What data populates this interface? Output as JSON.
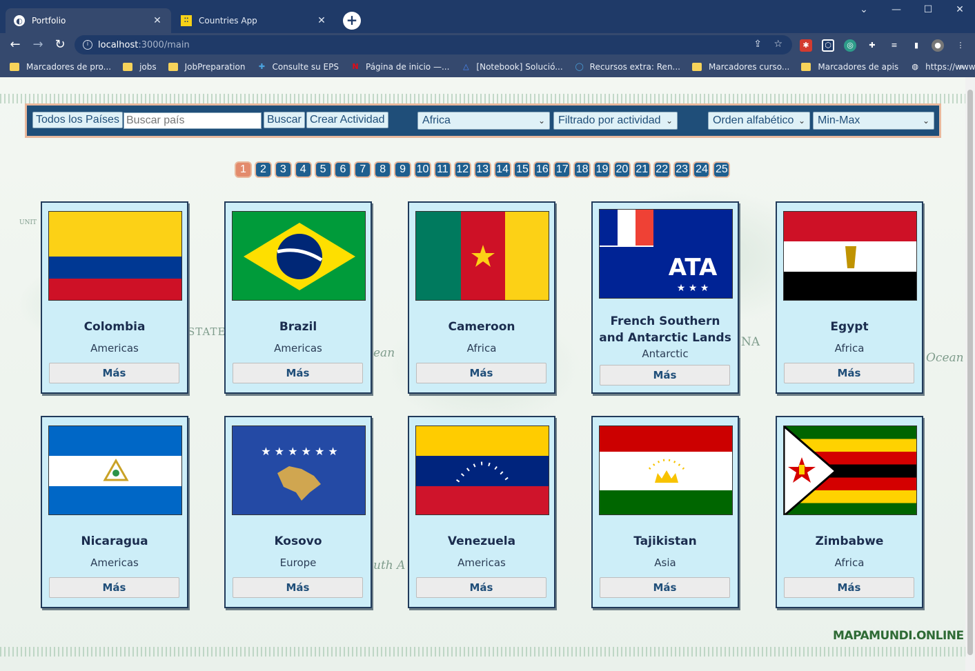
{
  "browser": {
    "tabs": [
      {
        "title": "Portfolio",
        "active": true
      },
      {
        "title": "Countries App",
        "active": false
      }
    ],
    "address": {
      "host": "localhost",
      "path": ":3000/main"
    },
    "bookmarks": [
      "Marcadores de pro...",
      "jobs",
      "JobPreparation",
      "Consulte su EPS",
      "Página de inicio —...",
      "[Notebook] Solució...",
      "Recursos extra: Ren...",
      "Marcadores curso...",
      "Marcadores de apis",
      "https://www.youtub..."
    ],
    "bookmarks_more": "»"
  },
  "nav": {
    "all_countries": "Todos los Países",
    "search_placeholder": "Buscar país",
    "search_button": "Buscar",
    "create_activity": "Crear Actividad",
    "continent_filter": "Africa",
    "activity_filter": "Filtrado por actividad",
    "order_type": "Orden alfabético",
    "order_direction": "Min-Max"
  },
  "pagination": {
    "current": 1,
    "pages": [
      "1",
      "2",
      "3",
      "4",
      "5",
      "6",
      "7",
      "8",
      "9",
      "10",
      "11",
      "12",
      "13",
      "14",
      "15",
      "16",
      "17",
      "18",
      "19",
      "20",
      "21",
      "22",
      "23",
      "24",
      "25"
    ]
  },
  "countries": [
    {
      "name": "Colombia",
      "continent": "Americas",
      "more": "Más"
    },
    {
      "name": "Brazil",
      "continent": "Americas",
      "more": "Más"
    },
    {
      "name": "Cameroon",
      "continent": "Africa",
      "more": "Más"
    },
    {
      "name": "French Southern and Antarctic Lands",
      "continent": "Antarctic",
      "more": "Más"
    },
    {
      "name": "Egypt",
      "continent": "Africa",
      "more": "Más"
    },
    {
      "name": "Nicaragua",
      "continent": "Americas",
      "more": "Más"
    },
    {
      "name": "Kosovo",
      "continent": "Europe",
      "more": "Más"
    },
    {
      "name": "Venezuela",
      "continent": "Americas",
      "more": "Más"
    },
    {
      "name": "Tajikistan",
      "continent": "Asia",
      "more": "Más"
    },
    {
      "name": "Zimbabwe",
      "continent": "Africa",
      "more": "Más"
    }
  ],
  "background_map_words": [
    "STATE",
    "Ocean",
    "ean",
    "NA",
    "uth A",
    "UNIT"
  ],
  "watermark": "MAPAMUNDI.ONLINE"
}
